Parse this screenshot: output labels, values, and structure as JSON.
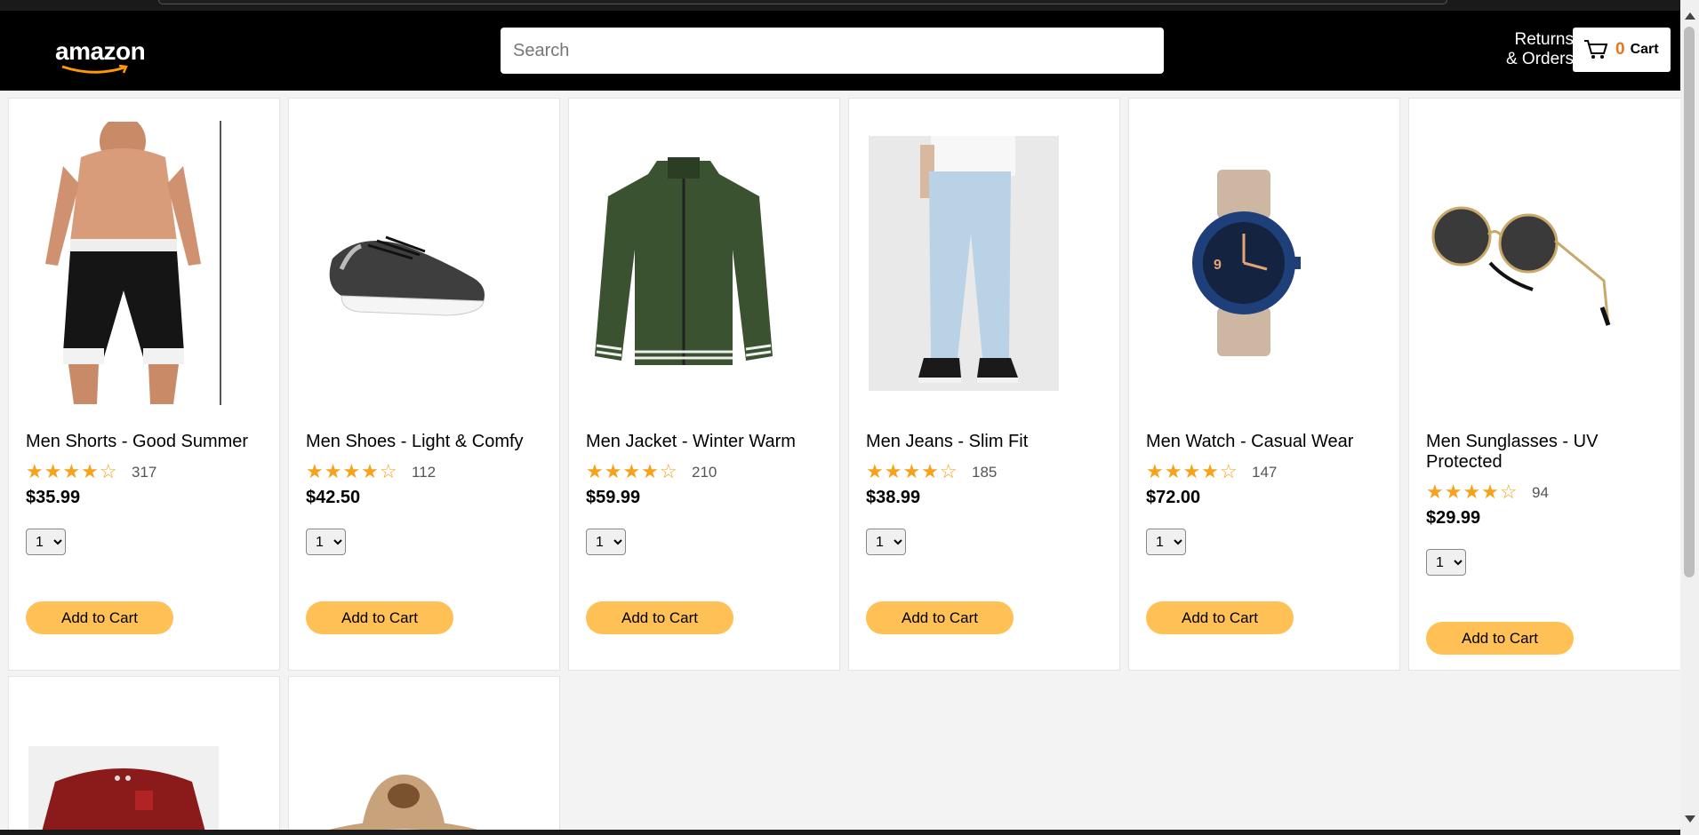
{
  "header": {
    "logo_text": "amazon",
    "search_placeholder": "Search",
    "returns_line1": "Returns",
    "returns_line2": "& Orders",
    "cart_count": "0",
    "cart_label": "Cart",
    "colors": {
      "background": "#000000",
      "cart_count": "#e7761a"
    }
  },
  "products": [
    {
      "name": "Men Shorts - Good Summer",
      "stars": "★★★★☆",
      "rating_count": "317",
      "price": "$35.99",
      "quantity": "1",
      "button": "Add to Cart",
      "icon": "shorts-image"
    },
    {
      "name": "Men Shoes - Light & Comfy",
      "stars": "★★★★☆",
      "rating_count": "112",
      "price": "$42.50",
      "quantity": "1",
      "button": "Add to Cart",
      "icon": "shoes-image"
    },
    {
      "name": "Men Jacket - Winter Warm",
      "stars": "★★★★☆",
      "rating_count": "210",
      "price": "$59.99",
      "quantity": "1",
      "button": "Add to Cart",
      "icon": "jacket-image"
    },
    {
      "name": "Men Jeans - Slim Fit",
      "stars": "★★★★☆",
      "rating_count": "185",
      "price": "$38.99",
      "quantity": "1",
      "button": "Add to Cart",
      "icon": "jeans-image"
    },
    {
      "name": "Men Watch - Casual Wear",
      "stars": "★★★★☆",
      "rating_count": "147",
      "price": "$72.00",
      "quantity": "1",
      "button": "Add to Cart",
      "icon": "watch-image"
    },
    {
      "name": "Men Sunglasses - UV Protected",
      "stars": "★★★★☆",
      "rating_count": "94",
      "price": "$29.99",
      "quantity": "1",
      "button": "Add to Cart",
      "icon": "sunglasses-image"
    }
  ],
  "partial_products": [
    {
      "icon": "shirt-image"
    },
    {
      "icon": "hat-image"
    }
  ],
  "colors": {
    "button": "#ffc155",
    "stars": "#f7a21b",
    "page_background": "#f3f3f3"
  }
}
